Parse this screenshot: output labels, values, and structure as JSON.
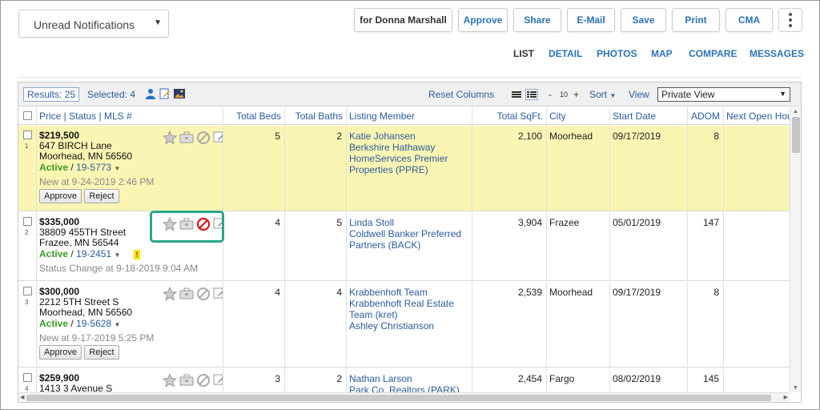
{
  "top": {
    "filter_value": "Unread Notifications",
    "buttons": {
      "for_user": "for Donna Marshall",
      "approve": "Approve",
      "share": "Share",
      "email": "E-Mail",
      "save": "Save",
      "print": "Print",
      "cma": "CMA"
    }
  },
  "tabs": [
    "LIST",
    "DETAIL",
    "PHOTOS",
    "MAP",
    "COMPARE",
    "MESSAGES"
  ],
  "toolbar": {
    "results": "Results: 25",
    "selected": "Selected: 4",
    "reset_columns": "Reset Columns",
    "minus": "-",
    "page_size": "10",
    "plus": "+",
    "sort": "Sort",
    "view_label": "View",
    "view_value": "Private View"
  },
  "columns": [
    "Price",
    "Status",
    "MLS #",
    "Total Beds",
    "Total Baths",
    "Listing Member",
    "Total SqFt.",
    "City",
    "Start Date",
    "ADOM",
    "Next Open Hou"
  ],
  "rows": [
    {
      "num": "1",
      "price": "$219,500",
      "address1": "647 BIRCH Lane",
      "address2": "Moorhead, MN 56560",
      "status": "Active",
      "sep": " / ",
      "mls": "19-5773",
      "note": "New at 9-24-2019 2:46 PM",
      "approve": "Approve",
      "reject": "Reject",
      "beds": "5",
      "baths": "2",
      "member": [
        "Katie Johansen",
        "Berkshire Hathaway",
        "HomeServices Premier",
        "Properties (PPRE)"
      ],
      "sqft": "2,100",
      "city": "Moorhead",
      "start": "09/17/2019",
      "adom": "8"
    },
    {
      "num": "2",
      "price": "$335,000",
      "address1": "38809 455TH Street",
      "address2": "Frazee, MN 56544",
      "status": "Active",
      "sep": " / ",
      "mls": "19-2451",
      "flag": "!",
      "note": "Status Change at 9-18-2019 9:04 AM",
      "beds": "4",
      "baths": "5",
      "member": [
        "Linda Stoll",
        "Coldwell Banker Preferred",
        "Partners (BACK)"
      ],
      "sqft": "3,904",
      "city": "Frazee",
      "start": "05/01/2019",
      "adom": "147"
    },
    {
      "num": "3",
      "price": "$300,000",
      "address1": "2212 5TH Street S",
      "address2": "Moorhead, MN 56560",
      "status": "Active",
      "sep": " / ",
      "mls": "19-5628",
      "note": "New at 9-17-2019 5:25 PM",
      "approve": "Approve",
      "reject": "Reject",
      "beds": "4",
      "baths": "4",
      "member": [
        "Krabbenhoft Team",
        "Krabbenhoft Real Estate",
        "Team (kret)",
        "Ashley Christianson"
      ],
      "sqft": "2,539",
      "city": "Moorhead",
      "start": "09/17/2019",
      "adom": "8"
    },
    {
      "num": "4",
      "price": "$259,900",
      "address1": "1413 3 Avenue S",
      "beds": "3",
      "baths": "2",
      "member": [
        "Nathan Larson",
        "Park Co. Realtors (PARK)"
      ],
      "sqft": "2,454",
      "city": "Fargo",
      "start": "08/02/2019",
      "adom": "145"
    }
  ]
}
